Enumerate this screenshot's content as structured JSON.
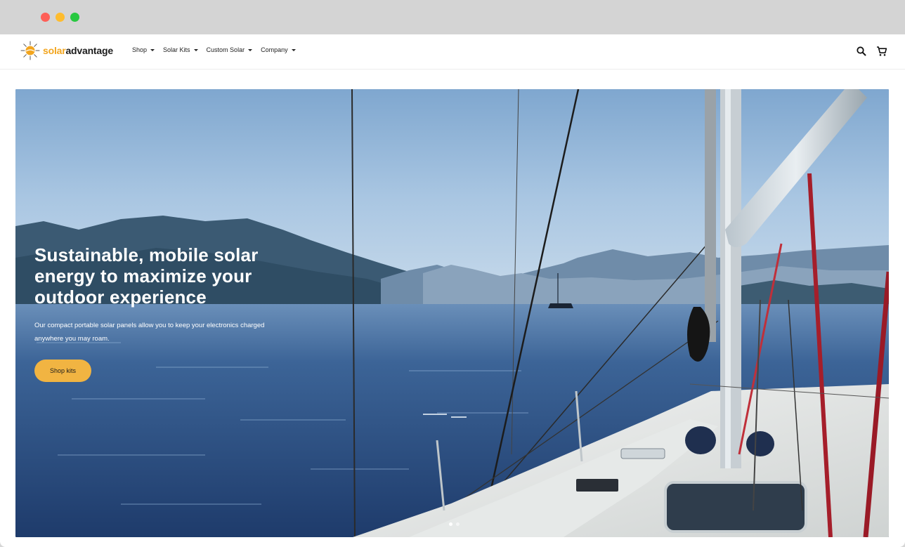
{
  "brand": {
    "name_part1": "solar",
    "name_part2": "advantage",
    "accent": "#f2a51e"
  },
  "nav": {
    "items": [
      {
        "label": "Shop"
      },
      {
        "label": "Solar Kits"
      },
      {
        "label": "Custom Solar"
      },
      {
        "label": "Company"
      }
    ],
    "search_icon": "search-icon",
    "cart_icon": "cart-icon"
  },
  "hero": {
    "headline": "Sustainable, mobile solar energy to maximize your outdoor experience",
    "subtext": "Our compact portable solar panels allow you to keep your electronics charged anywhere you may roam.",
    "cta_label": "Shop kits",
    "cta_color": "#f1b442",
    "slides": {
      "count": 2,
      "active": 1
    }
  }
}
